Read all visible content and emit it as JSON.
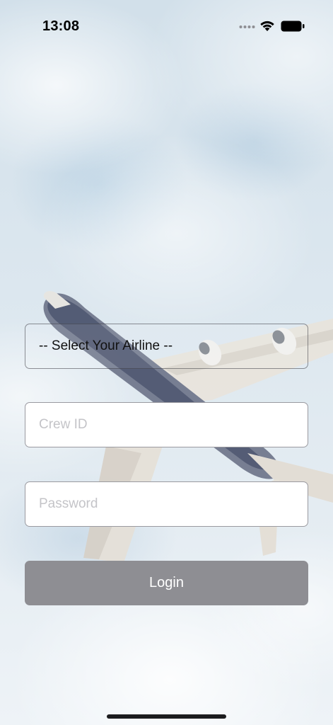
{
  "status_bar": {
    "time": "13:08",
    "icons": [
      "signal-dots-icon",
      "wifi-icon",
      "battery-icon"
    ]
  },
  "background": {
    "image": "airplane-sky-photo"
  },
  "login_form": {
    "airline_select": {
      "selected": "-- Select Your Airline --"
    },
    "crew_id": {
      "placeholder": "Crew ID",
      "value": ""
    },
    "password": {
      "placeholder": "Password",
      "value": ""
    },
    "login_label": "Login"
  },
  "colors": {
    "login_button_bg": "#8e8e93",
    "login_button_text": "#ffffff",
    "input_bg": "#ffffff",
    "placeholder": "#c4c4c8",
    "sky": "#d2e0ea"
  }
}
